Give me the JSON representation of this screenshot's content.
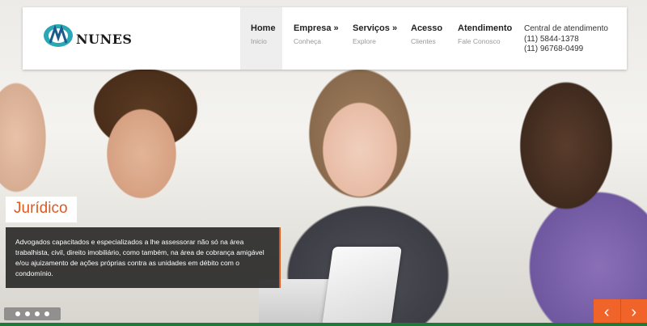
{
  "brand": {
    "name": "NUNES",
    "colors": {
      "accent": "#e2581c",
      "arrow_bg": "#f0642a",
      "logo_teal": "#2aa7b5"
    }
  },
  "nav": [
    {
      "title": "Home",
      "sub": "Inicio",
      "has_submenu": false,
      "active": true
    },
    {
      "title": "Empresa",
      "sub": "Conheça",
      "has_submenu": true,
      "active": false
    },
    {
      "title": "Serviços",
      "sub": "Explore",
      "has_submenu": true,
      "active": false
    },
    {
      "title": "Acesso",
      "sub": "Clientes",
      "has_submenu": false,
      "active": false
    },
    {
      "title": "Atendimento",
      "sub": "Fale Conosco",
      "has_submenu": false,
      "active": false
    }
  ],
  "submenu_marker": "»",
  "contact": {
    "label": "Central de atendimento",
    "phone1": "(11) 5844-1378",
    "phone2": "(11) 96768-0499"
  },
  "slide": {
    "title": "Jurídico",
    "text": "Advogados capacitados e especializados a lhe assessorar não só na área trabalhista, civil, direito imobiliário, como também, na área de cobrança amigável e/ou ajuizamento de ações próprias contra as unidades em débito com o condomínio."
  },
  "slider": {
    "dots": 4,
    "prev": "‹",
    "next": "›"
  }
}
